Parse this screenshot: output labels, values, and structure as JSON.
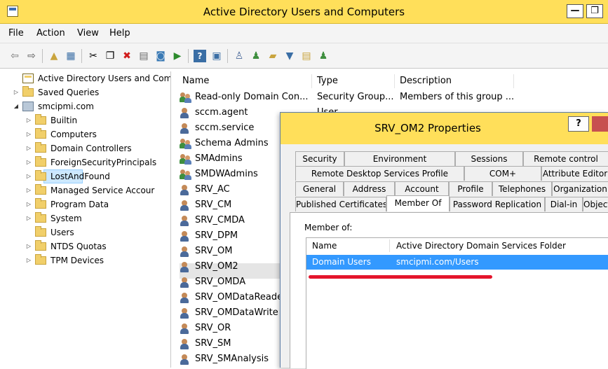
{
  "window": {
    "title": "Active Directory Users and Computers",
    "minimize_glyph": "—",
    "restore_glyph": "❐"
  },
  "menu": [
    "File",
    "Action",
    "View",
    "Help"
  ],
  "toolbar_icons": [
    "back-arrow-icon",
    "forward-arrow-icon",
    "up-folder-icon",
    "show-console-tree-icon",
    "cut-icon",
    "copy-icon",
    "delete-icon",
    "properties-icon",
    "refresh-icon",
    "export-list-icon",
    "help-icon",
    "show-action-pane-icon",
    "new-user-icon",
    "new-group-icon",
    "new-ou-icon",
    "filter-icon",
    "find-icon",
    "add-to-group-icon"
  ],
  "tree": [
    {
      "label": "Active Directory Users and Com",
      "kind": "root",
      "depth": 0,
      "expander": ""
    },
    {
      "label": "Saved Queries",
      "kind": "folder",
      "depth": 0,
      "expander": "▷"
    },
    {
      "label": "smcipmi.com",
      "kind": "domain",
      "depth": 0,
      "expander": "◢"
    },
    {
      "label": "Builtin",
      "kind": "folder",
      "depth": 1,
      "expander": "▷"
    },
    {
      "label": "Computers",
      "kind": "folder",
      "depth": 1,
      "expander": "▷"
    },
    {
      "label": "Domain Controllers",
      "kind": "ou",
      "depth": 1,
      "expander": "▷"
    },
    {
      "label": "ForeignSecurityPrincipals",
      "kind": "folder",
      "depth": 1,
      "expander": "▷"
    },
    {
      "label": "LostAndFound",
      "kind": "folder",
      "depth": 1,
      "expander": "▷"
    },
    {
      "label": "Managed Service Accour",
      "kind": "folder",
      "depth": 1,
      "expander": "▷"
    },
    {
      "label": "Program Data",
      "kind": "folder",
      "depth": 1,
      "expander": "▷"
    },
    {
      "label": "System",
      "kind": "folder",
      "depth": 1,
      "expander": "▷"
    },
    {
      "label": "Users",
      "kind": "folder",
      "depth": 1,
      "expander": "",
      "selected": true
    },
    {
      "label": "NTDS Quotas",
      "kind": "folder",
      "depth": 1,
      "expander": "▷"
    },
    {
      "label": "TPM Devices",
      "kind": "folder",
      "depth": 1,
      "expander": "▷"
    }
  ],
  "list": {
    "columns": [
      "Name",
      "Type",
      "Description"
    ],
    "rows": [
      {
        "name": "Read-only Domain Con...",
        "type": "Security Group...",
        "desc": "Members of this group ...",
        "kind": "group"
      },
      {
        "name": "sccm.agent",
        "type": "User",
        "desc": "",
        "kind": "user"
      },
      {
        "name": "sccm.service",
        "type": "",
        "desc": "",
        "kind": "user"
      },
      {
        "name": "Schema Admins",
        "type": "",
        "desc": "",
        "kind": "group"
      },
      {
        "name": "SMAdmins",
        "type": "",
        "desc": "",
        "kind": "group"
      },
      {
        "name": "SMDWAdmins",
        "type": "",
        "desc": "",
        "kind": "group"
      },
      {
        "name": "SRV_AC",
        "type": "",
        "desc": "",
        "kind": "user"
      },
      {
        "name": "SRV_CM",
        "type": "",
        "desc": "",
        "kind": "user"
      },
      {
        "name": "SRV_CMDA",
        "type": "",
        "desc": "",
        "kind": "user"
      },
      {
        "name": "SRV_DPM",
        "type": "",
        "desc": "",
        "kind": "user"
      },
      {
        "name": "SRV_OM",
        "type": "",
        "desc": "",
        "kind": "user"
      },
      {
        "name": "SRV_OM2",
        "type": "",
        "desc": "",
        "kind": "user",
        "selected": true
      },
      {
        "name": "SRV_OMDA",
        "type": "",
        "desc": "",
        "kind": "user"
      },
      {
        "name": "SRV_OMDataReade",
        "type": "",
        "desc": "",
        "kind": "user"
      },
      {
        "name": "SRV_OMDataWrite",
        "type": "",
        "desc": "",
        "kind": "user"
      },
      {
        "name": "SRV_OR",
        "type": "",
        "desc": "",
        "kind": "user"
      },
      {
        "name": "SRV_SM",
        "type": "",
        "desc": "",
        "kind": "user"
      },
      {
        "name": "SRV_SMAnalysis",
        "type": "",
        "desc": "",
        "kind": "user"
      }
    ]
  },
  "dialog": {
    "title": "SRV_OM2 Properties",
    "help_label": "?",
    "tabs_row1": [
      "Security",
      "Environment",
      "Sessions",
      "Remote control"
    ],
    "tabs_row2": [
      "Remote Desktop Services Profile",
      "COM+",
      "Attribute Editor"
    ],
    "tabs_row3": [
      "General",
      "Address",
      "Account",
      "Profile",
      "Telephones",
      "Organization"
    ],
    "tabs_row4": [
      "Published Certificates",
      "Member Of",
      "Password Replication",
      "Dial-in",
      "Object"
    ],
    "active_tab": "Member Of",
    "member_of_label": "Member of:",
    "columns": [
      "Name",
      "Active Directory Domain Services Folder"
    ],
    "rows": [
      {
        "name": "Domain Users",
        "folder": "smcipmi.com/Users"
      }
    ]
  },
  "colors": {
    "title_bar": "#ffdf5a",
    "selection": "#3399ff",
    "annotation": "#e4152c",
    "close_button": "#c75050"
  }
}
